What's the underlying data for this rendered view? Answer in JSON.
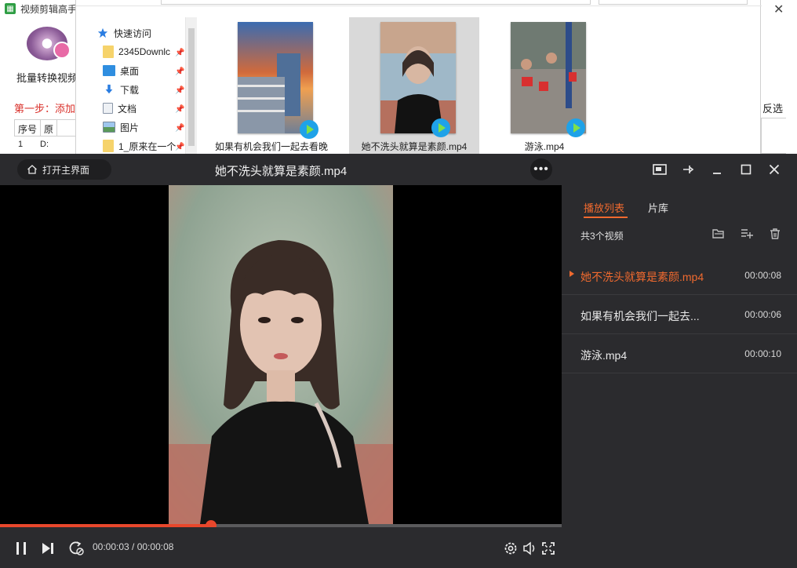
{
  "background_app": {
    "title": "视频剪辑高手",
    "batch_label": "批量转换视频",
    "step_label": "第一步：添加原",
    "invert_label": "反选",
    "table": {
      "headers": [
        "序号",
        "原"
      ],
      "row": [
        "1",
        "D:"
      ]
    }
  },
  "explorer": {
    "nav_items": [
      {
        "label": "快速访问",
        "icon": "star-icon"
      },
      {
        "label": "2345Downlc",
        "icon": "folder-icon"
      },
      {
        "label": "桌面",
        "icon": "desktop-icon"
      },
      {
        "label": "下载",
        "icon": "download-icon"
      },
      {
        "label": "文档",
        "icon": "document-icon"
      },
      {
        "label": "图片",
        "icon": "picture-icon"
      },
      {
        "label": "1_原来在一个",
        "icon": "folder-icon"
      }
    ],
    "files": [
      {
        "name": "如果有机会我们一起去看晚",
        "selected": false
      },
      {
        "name": "她不洗头就算是素颜.mp4",
        "selected": true
      },
      {
        "name": "游泳.mp4",
        "selected": false
      }
    ]
  },
  "player": {
    "home_label": "打开主界面",
    "title": "她不洗头就算是素颜.mp4",
    "more_label": "•••",
    "time": "00:00:03 / 00:00:08",
    "progress": 0.375,
    "sidebar": {
      "tab_playlist": "播放列表",
      "tab_library": "片库",
      "count_label": "共3个视频",
      "items": [
        {
          "name": "她不洗头就算是素颜.mp4",
          "duration": "00:00:08",
          "active": true
        },
        {
          "name": "如果有机会我们一起去...",
          "duration": "00:00:06",
          "active": false
        },
        {
          "name": "游泳.mp4",
          "duration": "00:00:10",
          "active": false
        }
      ]
    }
  },
  "colors": {
    "accent": "#f06a2f",
    "progress": "#e8472c",
    "player_bg": "#2b2b2e"
  }
}
